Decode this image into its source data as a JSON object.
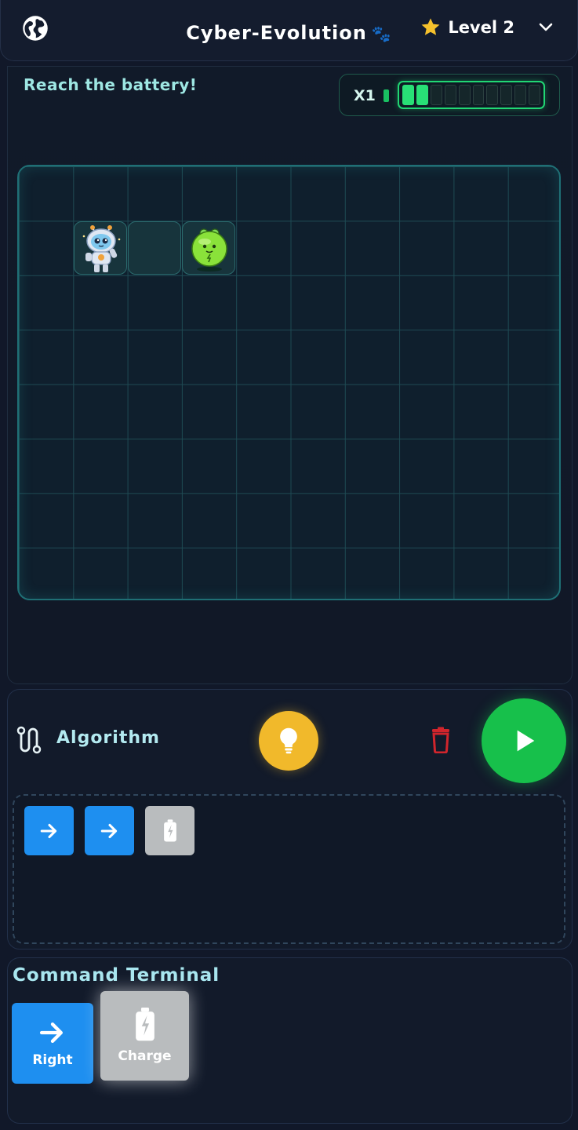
{
  "header": {
    "title": "Cyber-Evolution",
    "title_emoji": "🐾",
    "level_label": "Level 2"
  },
  "goal": {
    "text": "Reach the battery!"
  },
  "energy": {
    "multiplier": "X1",
    "segments_total": 10,
    "segments_filled": 2
  },
  "board": {
    "columns": 10,
    "rows": 8,
    "robot_cell": [
      1,
      1
    ],
    "path_cells": [
      [
        2,
        1
      ]
    ],
    "battery_cell": [
      3,
      1
    ]
  },
  "algorithm": {
    "title": "Algorithm",
    "program": [
      {
        "type": "right",
        "icon": "arrow-right-icon"
      },
      {
        "type": "right",
        "icon": "arrow-right-icon"
      },
      {
        "type": "charge",
        "icon": "battery-icon"
      }
    ]
  },
  "terminal": {
    "title": "Command Terminal",
    "commands": [
      {
        "label": "Right",
        "icon": "arrow-right-icon"
      },
      {
        "label": "Charge",
        "icon": "battery-icon"
      }
    ]
  },
  "colors": {
    "background": "#111829",
    "accent_blue": "#1e8ff0",
    "charge_gray": "#b9bcbe",
    "play_green": "#17c04b",
    "hint_yellow": "#f1b92b",
    "energy_green": "#28df76"
  }
}
